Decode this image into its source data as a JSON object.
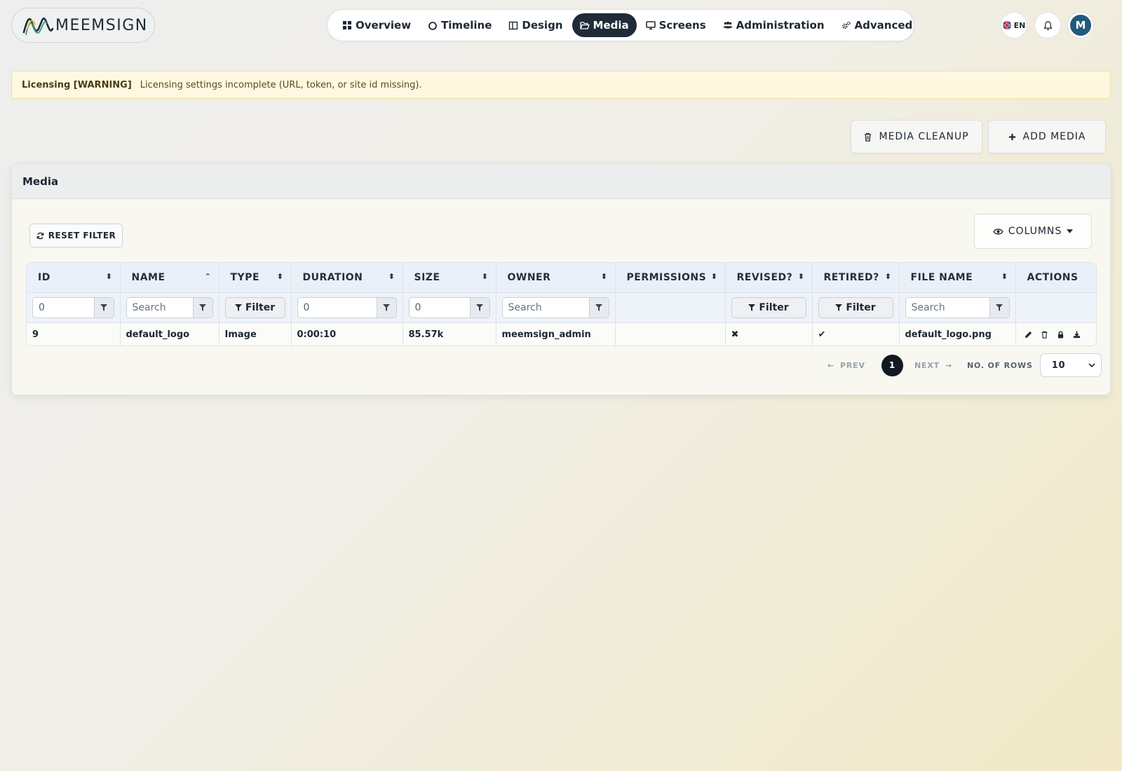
{
  "app": {
    "logo_text": "MEEMSIGN",
    "accent_color": "#1f2b38",
    "avatar_color": "#23597a"
  },
  "nav": {
    "items": [
      {
        "label": "Overview",
        "icon": "grid-icon"
      },
      {
        "label": "Timeline",
        "icon": "circle-icon"
      },
      {
        "label": "Design",
        "icon": "layout-icon"
      },
      {
        "label": "Media",
        "icon": "folder-open-icon",
        "active": true
      },
      {
        "label": "Screens",
        "icon": "monitor-icon"
      },
      {
        "label": "Administration",
        "icon": "users-icon"
      },
      {
        "label": "Advanced",
        "icon": "cogs-icon"
      }
    ]
  },
  "header": {
    "language": "EN",
    "avatar_initial": "M"
  },
  "alert": {
    "title": "Licensing [WARNING]",
    "message": "Licensing settings incomplete (URL, token, or site id missing)."
  },
  "toolbar": {
    "cleanup_label": "MEDIA CLEANUP",
    "add_label": "ADD MEDIA"
  },
  "card": {
    "title": "Media",
    "reset_filter_label": "RESET FILTER",
    "columns_label": "COLUMNS"
  },
  "table": {
    "columns": [
      "ID",
      "NAME",
      "TYPE",
      "DURATION",
      "SIZE",
      "OWNER",
      "PERMISSIONS",
      "REVISED?",
      "RETIRED?",
      "FILE NAME",
      "ACTIONS"
    ],
    "filters": {
      "id_value": "0",
      "name_placeholder": "Search",
      "type_label": "Filter",
      "duration_value": "0",
      "size_value": "0",
      "owner_placeholder": "Search",
      "revised_label": "Filter",
      "retired_label": "Filter",
      "filename_placeholder": "Search"
    },
    "rows": [
      {
        "id": "9",
        "name": "default_logo",
        "type": "Image",
        "duration": "0:00:10",
        "size": "85.57k",
        "owner": "meemsign_admin",
        "permissions": "",
        "revised": "✖",
        "retired": "✔",
        "file_name": "default_logo.png"
      }
    ]
  },
  "pagination": {
    "prev_label": "PREV",
    "next_label": "NEXT",
    "current_page": "1",
    "rows_label": "NO. OF ROWS",
    "rows_value": "10"
  }
}
